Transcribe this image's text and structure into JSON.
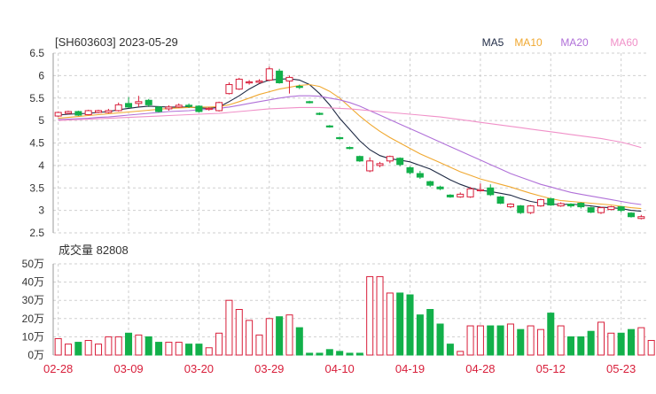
{
  "header": {
    "title": "[SH603603] 2023-05-29",
    "volume_label": "成交量 82808"
  },
  "legend": [
    {
      "name": "MA5",
      "color": "#1f2a44"
    },
    {
      "name": "MA10",
      "color": "#f0a830"
    },
    {
      "name": "MA20",
      "color": "#b070d8"
    },
    {
      "name": "MA60",
      "color": "#f090c8"
    }
  ],
  "colors": {
    "up": "#d81e3a",
    "down": "#12b04a",
    "grid": "#cfcfcf",
    "axis_text": "#333333",
    "date_text": "#d81e3a"
  },
  "chart_data": [
    {
      "type": "candlestick",
      "ylim": [
        2.5,
        6.5
      ],
      "yticks": [
        "2.5",
        "3",
        "3.5",
        "4",
        "4.5",
        "5",
        "5.5",
        "6",
        "6.5"
      ],
      "x_labels": [
        {
          "label": "02-28",
          "index": 0
        },
        {
          "label": "03-09",
          "index": 7
        },
        {
          "label": "03-20",
          "index": 14
        },
        {
          "label": "03-29",
          "index": 21
        },
        {
          "label": "04-10",
          "index": 28
        },
        {
          "label": "04-19",
          "index": 35
        },
        {
          "label": "04-28",
          "index": 42
        },
        {
          "label": "05-12",
          "index": 49
        },
        {
          "label": "05-23",
          "index": 56
        }
      ],
      "candles": [
        [
          5.1,
          5.18,
          5.2,
          5.08
        ],
        [
          5.16,
          5.2,
          5.22,
          5.14
        ],
        [
          5.2,
          5.12,
          5.22,
          5.1
        ],
        [
          5.13,
          5.22,
          5.24,
          5.12
        ],
        [
          5.18,
          5.22,
          5.24,
          5.16
        ],
        [
          5.18,
          5.22,
          5.26,
          5.16
        ],
        [
          5.22,
          5.35,
          5.4,
          5.2
        ],
        [
          5.38,
          5.3,
          5.52,
          5.28
        ],
        [
          5.38,
          5.42,
          5.55,
          5.3
        ],
        [
          5.45,
          5.35,
          5.48,
          5.3
        ],
        [
          5.3,
          5.2,
          5.32,
          5.18
        ],
        [
          5.26,
          5.3,
          5.34,
          5.22
        ],
        [
          5.3,
          5.34,
          5.38,
          5.28
        ],
        [
          5.34,
          5.32,
          5.38,
          5.28
        ],
        [
          5.32,
          5.2,
          5.34,
          5.18
        ],
        [
          5.25,
          5.27,
          5.3,
          5.22
        ],
        [
          5.22,
          5.4,
          5.42,
          5.2
        ],
        [
          5.6,
          5.8,
          5.85,
          5.58
        ],
        [
          5.7,
          5.92,
          5.95,
          5.68
        ],
        [
          5.84,
          5.86,
          5.9,
          5.8
        ],
        [
          5.85,
          5.88,
          5.92,
          5.82
        ],
        [
          5.9,
          6.15,
          6.2,
          5.88
        ],
        [
          6.1,
          5.84,
          6.15,
          5.82
        ],
        [
          5.88,
          5.96,
          6.0,
          5.6
        ],
        [
          5.76,
          5.74,
          5.8,
          5.7
        ],
        [
          5.42,
          5.4,
          5.44,
          5.38
        ],
        [
          5.16,
          5.14,
          5.18,
          5.12
        ],
        [
          4.88,
          4.86,
          4.9,
          4.84
        ],
        [
          4.62,
          4.6,
          4.64,
          4.58
        ],
        [
          4.4,
          4.38,
          4.42,
          4.36
        ],
        [
          4.2,
          4.1,
          4.22,
          4.08
        ],
        [
          3.88,
          4.1,
          4.18,
          3.85
        ],
        [
          4.0,
          4.04,
          4.08,
          3.96
        ],
        [
          4.1,
          4.2,
          4.22,
          4.05
        ],
        [
          4.16,
          4.02,
          4.18,
          3.98
        ],
        [
          3.95,
          3.84,
          3.98,
          3.8
        ],
        [
          3.82,
          3.74,
          3.88,
          3.7
        ],
        [
          3.64,
          3.56,
          3.66,
          3.52
        ],
        [
          3.52,
          3.48,
          3.55,
          3.45
        ],
        [
          3.34,
          3.3,
          3.36,
          3.28
        ],
        [
          3.3,
          3.36,
          3.4,
          3.28
        ],
        [
          3.3,
          3.48,
          3.52,
          3.28
        ],
        [
          3.44,
          3.46,
          3.6,
          3.42
        ],
        [
          3.5,
          3.35,
          3.58,
          3.32
        ],
        [
          3.3,
          3.16,
          3.32,
          3.14
        ],
        [
          3.08,
          3.14,
          3.16,
          3.05
        ],
        [
          3.1,
          2.95,
          3.12,
          2.92
        ],
        [
          2.95,
          3.1,
          3.12,
          2.92
        ],
        [
          3.1,
          3.24,
          3.26,
          3.08
        ],
        [
          3.26,
          3.12,
          3.28,
          3.1
        ],
        [
          3.1,
          3.15,
          3.18,
          3.08
        ],
        [
          3.14,
          3.1,
          3.16,
          3.06
        ],
        [
          3.16,
          3.08,
          3.18,
          3.04
        ],
        [
          3.06,
          2.96,
          3.08,
          2.94
        ],
        [
          2.95,
          3.06,
          3.08,
          2.92
        ],
        [
          3.02,
          3.08,
          3.1,
          3.0
        ],
        [
          3.08,
          3.0,
          3.1,
          2.96
        ],
        [
          2.94,
          2.86,
          2.96,
          2.84
        ],
        [
          2.82,
          2.86,
          2.9,
          2.8
        ]
      ],
      "ma": {
        "MA5": [
          5.12,
          5.14,
          5.15,
          5.16,
          5.18,
          5.2,
          5.24,
          5.27,
          5.3,
          5.32,
          5.31,
          5.3,
          5.3,
          5.3,
          5.28,
          5.27,
          5.3,
          5.42,
          5.55,
          5.7,
          5.82,
          5.9,
          5.92,
          5.93,
          5.9,
          5.8,
          5.6,
          5.35,
          5.05,
          4.8,
          4.55,
          4.35,
          4.22,
          4.15,
          4.12,
          4.08,
          4.0,
          3.92,
          3.8,
          3.68,
          3.58,
          3.5,
          3.45,
          3.42,
          3.38,
          3.34,
          3.26,
          3.2,
          3.16,
          3.14,
          3.13,
          3.14,
          3.12,
          3.1,
          3.07,
          3.06,
          3.04,
          3.0,
          2.98
        ],
        "MA10": [
          5.05,
          5.07,
          5.09,
          5.11,
          5.13,
          5.15,
          5.17,
          5.19,
          5.21,
          5.23,
          5.25,
          5.27,
          5.28,
          5.29,
          5.3,
          5.3,
          5.31,
          5.35,
          5.42,
          5.5,
          5.58,
          5.64,
          5.7,
          5.74,
          5.78,
          5.8,
          5.76,
          5.65,
          5.5,
          5.3,
          5.1,
          4.92,
          4.76,
          4.62,
          4.5,
          4.38,
          4.26,
          4.16,
          4.06,
          3.96,
          3.86,
          3.78,
          3.7,
          3.64,
          3.58,
          3.52,
          3.45,
          3.38,
          3.32,
          3.26,
          3.22,
          3.2,
          3.18,
          3.16,
          3.14,
          3.12,
          3.09,
          3.06,
          3.04
        ],
        "MA20": [
          5.02,
          5.03,
          5.04,
          5.05,
          5.07,
          5.08,
          5.1,
          5.12,
          5.14,
          5.16,
          5.18,
          5.2,
          5.21,
          5.22,
          5.24,
          5.25,
          5.27,
          5.3,
          5.34,
          5.38,
          5.42,
          5.46,
          5.5,
          5.53,
          5.55,
          5.55,
          5.54,
          5.5,
          5.46,
          5.4,
          5.32,
          5.22,
          5.12,
          5.02,
          4.92,
          4.82,
          4.72,
          4.62,
          4.52,
          4.42,
          4.32,
          4.22,
          4.12,
          4.02,
          3.92,
          3.82,
          3.74,
          3.66,
          3.58,
          3.52,
          3.46,
          3.4,
          3.36,
          3.32,
          3.28,
          3.24,
          3.2,
          3.16,
          3.13
        ],
        "MA60": [
          5.0,
          5.01,
          5.02,
          5.03,
          5.04,
          5.05,
          5.06,
          5.07,
          5.08,
          5.09,
          5.1,
          5.11,
          5.12,
          5.13,
          5.14,
          5.15,
          5.16,
          5.18,
          5.2,
          5.22,
          5.24,
          5.26,
          5.27,
          5.28,
          5.29,
          5.29,
          5.29,
          5.28,
          5.27,
          5.26,
          5.24,
          5.22,
          5.2,
          5.18,
          5.16,
          5.14,
          5.12,
          5.1,
          5.08,
          5.05,
          5.02,
          4.99,
          4.96,
          4.93,
          4.9,
          4.87,
          4.84,
          4.81,
          4.78,
          4.75,
          4.72,
          4.69,
          4.66,
          4.63,
          4.6,
          4.56,
          4.52,
          4.46,
          4.4
        ]
      }
    },
    {
      "type": "bar",
      "title": "成交量 82808",
      "ylim": [
        0,
        50
      ],
      "yticks": [
        "0万",
        "10万",
        "20万",
        "30万",
        "40万",
        "50万"
      ],
      "volumes": [
        9,
        6,
        7,
        8,
        6,
        10,
        10,
        12,
        11,
        10,
        7,
        7,
        7,
        6,
        6,
        4,
        12,
        30,
        25,
        19,
        11,
        20,
        21,
        22,
        15,
        1,
        1,
        3,
        2,
        1,
        1,
        43,
        43,
        34,
        34,
        33,
        22,
        25,
        17,
        6,
        2,
        16,
        16,
        16,
        16,
        17,
        14,
        16,
        14,
        23,
        16,
        10,
        10,
        13,
        18,
        12,
        12,
        14,
        15,
        8
      ]
    }
  ]
}
